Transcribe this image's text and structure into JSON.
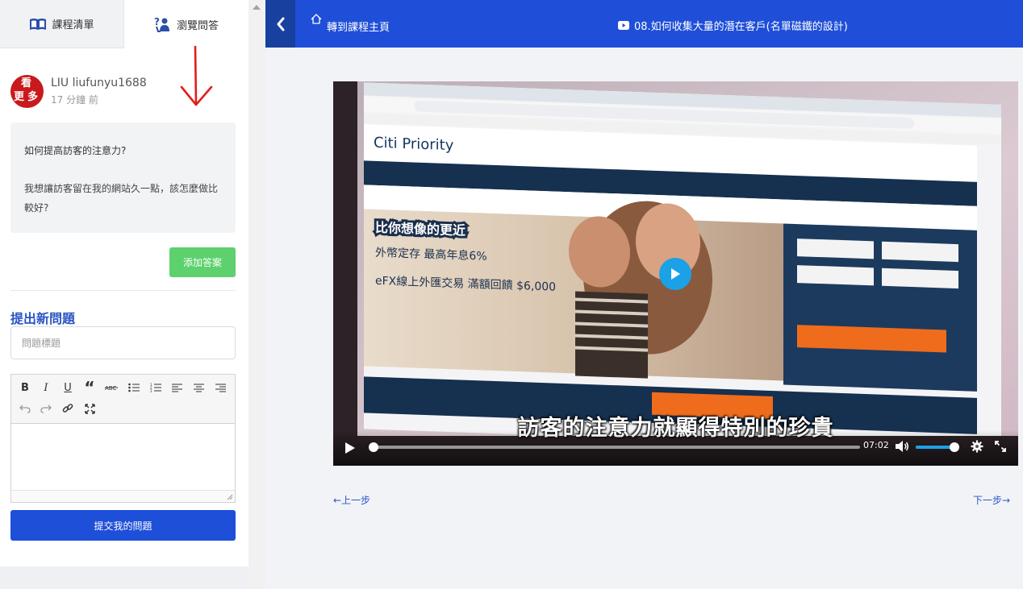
{
  "sidebar": {
    "tabs": [
      {
        "label": "課程清單",
        "icon": "book-icon"
      },
      {
        "label": "瀏覽問答",
        "icon": "qa-icon"
      }
    ],
    "question": {
      "user_name": "LIU liufunyu1688",
      "time_ago": "17 分鐘 前",
      "avatar_text": [
        "看",
        "更",
        "多"
      ],
      "title": "如何提高訪客的注意力?",
      "body": "我想讓訪客留在我的網站久一點，該怎麼做比較好?"
    },
    "add_answer_label": "添加答案",
    "new_question": {
      "heading": "提出新問題",
      "title_placeholder": "問題標題",
      "submit_label": "提交我的問題"
    },
    "annotation_color": "#e11d1d"
  },
  "header": {
    "home_label": "轉到課程主頁",
    "lesson_title": "08.如何收集大量的潛在客戶(名單磁鐵的設計)"
  },
  "video": {
    "subtitle": "訪客的注意力就顯得特別的珍貴",
    "current_time": "07:02",
    "progress_fraction": 0.01,
    "volume_fraction": 0.96,
    "accent_color": "#1aa1e6"
  },
  "navigation": {
    "prev_label": "←上一步",
    "next_label": "下一步→"
  }
}
